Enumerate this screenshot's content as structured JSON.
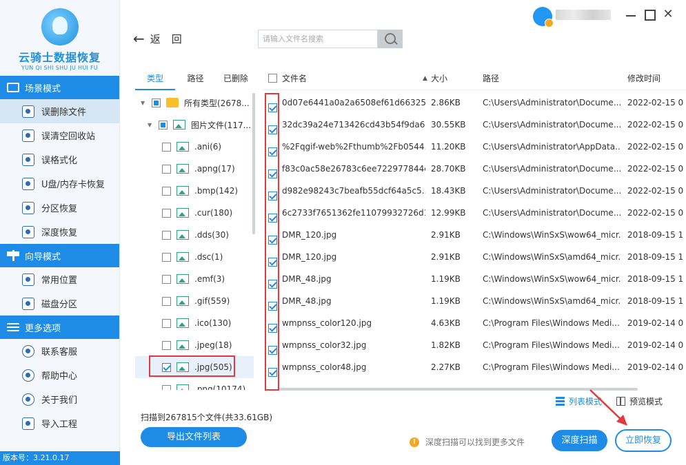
{
  "app": {
    "name": "云骑士数据恢复",
    "subtitle": "YUN QI SHI SHU JU HUI FU",
    "version": "版本号：3.21.0.17"
  },
  "sidebar": {
    "sections": [
      {
        "title": "场景模式",
        "icon": "monitor-icon",
        "items": [
          {
            "label": "误删除文件",
            "icon": "delete-file-icon",
            "active": true
          },
          {
            "label": "误清空回收站",
            "icon": "recycle-bin-icon"
          },
          {
            "label": "误格式化",
            "icon": "format-icon"
          },
          {
            "label": "U盘/内存卡恢复",
            "icon": "usb-drive-icon"
          },
          {
            "label": "分区恢复",
            "icon": "partition-icon"
          },
          {
            "label": "深度恢复",
            "icon": "deep-recovery-icon"
          }
        ]
      },
      {
        "title": "向导模式",
        "icon": "signpost-icon",
        "items": [
          {
            "label": "常用位置",
            "icon": "windows-icon"
          },
          {
            "label": "磁盘分区",
            "icon": "disk-icon"
          }
        ]
      },
      {
        "title": "更多选项",
        "icon": "menu-icon",
        "items": [
          {
            "label": "联系客服",
            "icon": "phone-icon"
          },
          {
            "label": "帮助中心",
            "icon": "help-icon"
          },
          {
            "label": "关于我们",
            "icon": "info-icon"
          },
          {
            "label": "导入工程",
            "icon": "import-icon"
          }
        ]
      }
    ]
  },
  "toolbar": {
    "back_label": "返回",
    "search_placeholder": "请输入文件名搜索"
  },
  "tree": {
    "tabs": [
      "类型",
      "路径",
      "已删除"
    ],
    "nodes": [
      {
        "label": "所有类型(2678...",
        "kind": "folder",
        "level": 0,
        "check": "partial",
        "caret": "▼"
      },
      {
        "label": "图片文件(117...",
        "kind": "image",
        "level": 1,
        "check": "partial",
        "caret": "▼"
      },
      {
        "label": ".ani(6)",
        "kind": "image",
        "level": 2,
        "check": "none"
      },
      {
        "label": ".apng(17)",
        "kind": "image",
        "level": 2,
        "check": "none"
      },
      {
        "label": ".bmp(142)",
        "kind": "image",
        "level": 2,
        "check": "none"
      },
      {
        "label": ".cur(180)",
        "kind": "image",
        "level": 2,
        "check": "none"
      },
      {
        "label": ".dds(30)",
        "kind": "image",
        "level": 2,
        "check": "none"
      },
      {
        "label": ".dsc(1)",
        "kind": "image",
        "level": 2,
        "check": "none"
      },
      {
        "label": ".emf(3)",
        "kind": "image",
        "level": 2,
        "check": "none"
      },
      {
        "label": ".gif(559)",
        "kind": "image",
        "level": 2,
        "check": "none"
      },
      {
        "label": ".ico(130)",
        "kind": "image",
        "level": 2,
        "check": "none"
      },
      {
        "label": ".jpeg(18)",
        "kind": "image",
        "level": 2,
        "check": "none"
      },
      {
        "label": ".jpg(505)",
        "kind": "image",
        "level": 2,
        "check": "checked",
        "selected": true
      },
      {
        "label": ".png(10174)",
        "kind": "image",
        "level": 2,
        "check": "none"
      }
    ]
  },
  "table": {
    "headers": {
      "name": "文件名",
      "size": "大小",
      "path": "路径",
      "date": "修改时间"
    },
    "sort_indicator": "▲",
    "rows": [
      {
        "name": "0d07e6441a0a2a6508ef61d66325...",
        "size": "2.86KB",
        "path": "C:\\Users\\Administrator\\Docume...",
        "date": "2022-02-15 0"
      },
      {
        "name": "32dc39a24e713426cd43b54f9da6...",
        "size": "30.55KB",
        "path": "C:\\Users\\Administrator\\Docume...",
        "date": "2022-02-15 0"
      },
      {
        "name": "%2Fqgif-web%2Fthumb%2Fb0544...",
        "size": "11.20KB",
        "path": "C:\\Users\\Administrator\\AppData...",
        "date": "2022-02-15 0"
      },
      {
        "name": "f83c0ac58e26783c6ee722977844c...",
        "size": "28.70KB",
        "path": "C:\\Users\\Administrator\\Docume...",
        "date": "2022-02-15 0"
      },
      {
        "name": "d982e98243c7beafb55dcf64a5c5...",
        "size": "18.43KB",
        "path": "C:\\Users\\Administrator\\Docume...",
        "date": "2022-02-15 0"
      },
      {
        "name": "6c2733f7651362fe11079932726d1...",
        "size": "12.99KB",
        "path": "C:\\Users\\Administrator\\Docume...",
        "date": "2022-02-15 0"
      },
      {
        "name": "DMR_120.jpg",
        "size": "2.91KB",
        "path": "C:\\Windows\\WinSxS\\wow64_micr...",
        "date": "2018-09-15 1"
      },
      {
        "name": "DMR_120.jpg",
        "size": "2.91KB",
        "path": "C:\\Windows\\WinSxS\\amd64_micr...",
        "date": "2018-09-15 1"
      },
      {
        "name": "DMR_48.jpg",
        "size": "1.19KB",
        "path": "C:\\Windows\\WinSxS\\wow64_micr...",
        "date": "2018-09-15 1"
      },
      {
        "name": "DMR_48.jpg",
        "size": "1.19KB",
        "path": "C:\\Windows\\WinSxS\\amd64_micr...",
        "date": "2018-09-15 1"
      },
      {
        "name": "wmpnss_color120.jpg",
        "size": "4.63KB",
        "path": "C:\\Program Files\\Windows Medi...",
        "date": "2019-02-14 0"
      },
      {
        "name": "wmpnss_color32.jpg",
        "size": "1.82KB",
        "path": "C:\\Program Files\\Windows Medi...",
        "date": "2019-02-14 0"
      },
      {
        "name": "wmpnss_color48.jpg",
        "size": "2.27KB",
        "path": "C:\\Program Files\\Windows Medi...",
        "date": "2019-02-14 0"
      }
    ]
  },
  "view_modes": {
    "list": "列表模式",
    "preview": "预览模式"
  },
  "footer": {
    "scan_summary": "扫描到267815个文件(共33.61GB)",
    "export_label": "导出文件列表",
    "hint": "深度扫描可以找到更多文件",
    "deep_scan_label": "深度扫描",
    "recover_label": "立即恢复"
  },
  "colors": {
    "accent": "#1e8ce6",
    "highlight": "#e0393e",
    "warning": "#f5a623"
  }
}
